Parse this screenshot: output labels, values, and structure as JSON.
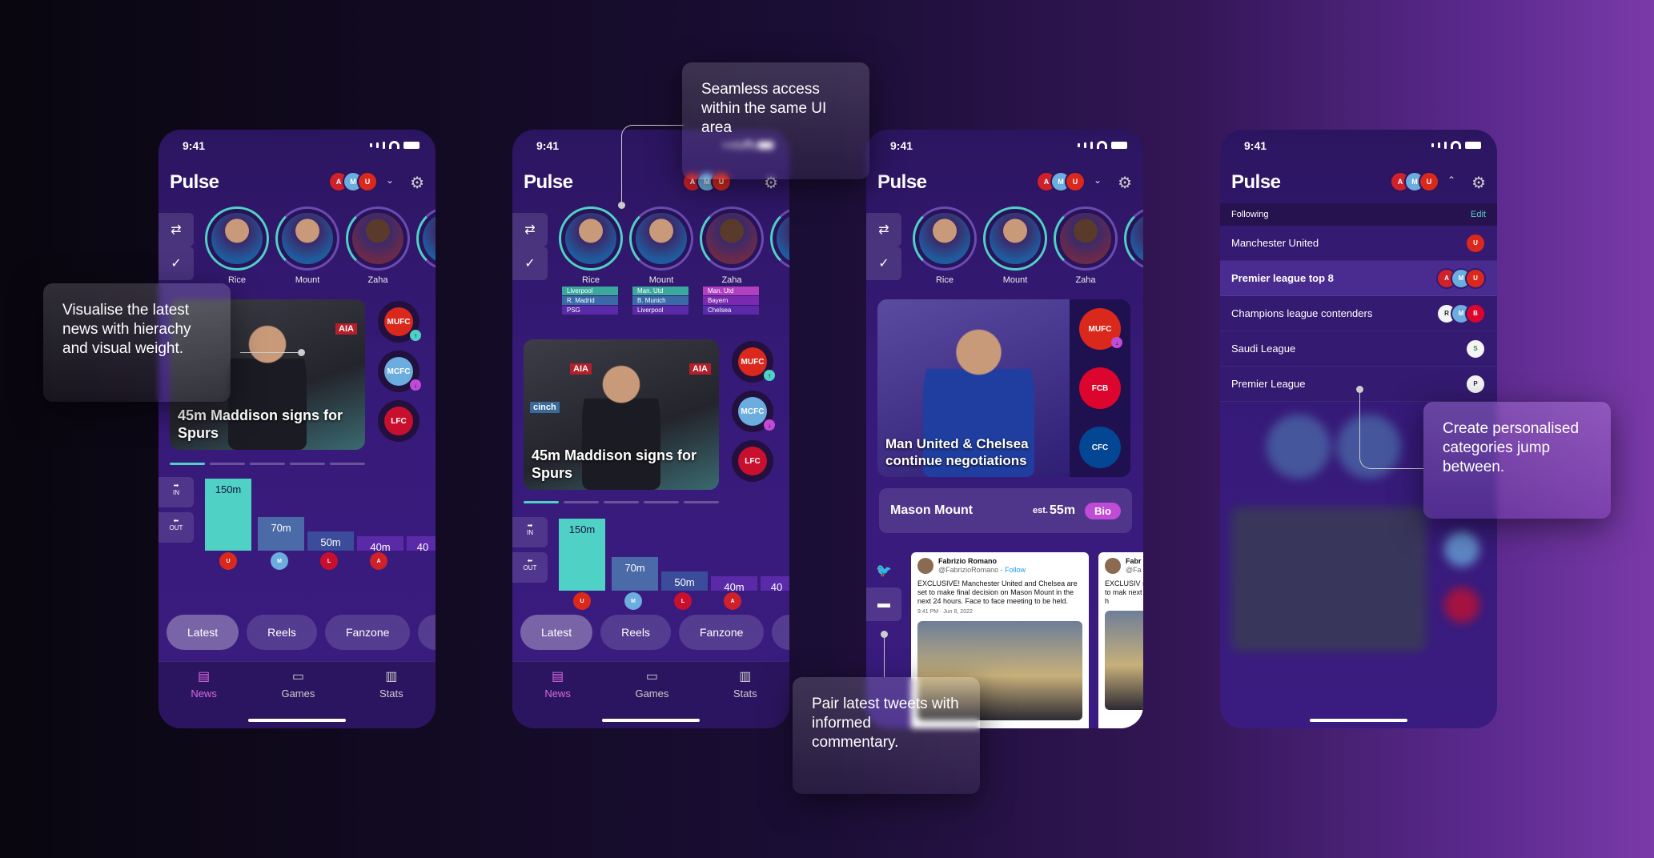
{
  "status_time": "9:41",
  "app_name": "Pulse",
  "players": [
    "Rice",
    "Mount",
    "Zaha"
  ],
  "headline": "45m Maddison signs for Spurs",
  "headline2": "Man United & Chelsea continue negotiations",
  "transfer_bars": [
    "150m",
    "70m",
    "50m",
    "40m",
    "40"
  ],
  "transfer_in": "IN",
  "transfer_out": "OUT",
  "chips": [
    "Latest",
    "Reels",
    "Fanzone",
    "Fa"
  ],
  "tabs": [
    "News",
    "Games",
    "Stats"
  ],
  "tags": {
    "rice": [
      "Liverpool",
      "R. Madrid",
      "PSG"
    ],
    "mount": [
      "Man. Utd",
      "B. Munich",
      "Liverpool"
    ],
    "zaha": [
      "Man. Utd",
      "Bayern",
      "Chelsea"
    ]
  },
  "mount_bar": {
    "name": "Mason Mount",
    "est_prefix": "est.",
    "est_value": "55m",
    "bio": "Bio"
  },
  "tweet": {
    "author": "Fabrizio Romano",
    "handle": "@FabrizioRomano",
    "follow": "Follow",
    "text": "EXCLUSIVE! Manchester United and Chelsea are set to make final decision on Mason Mount in the next 24 hours. Face to face meeting to be held.",
    "time": "9:41 PM · Jun 8, 2022"
  },
  "tweet2": {
    "author": "Fabr",
    "handle": "@Fa",
    "text": "EXCLUSIV set to mak next 24 h"
  },
  "following": {
    "title": "Following",
    "edit": "Edit",
    "items": [
      "Manchester United",
      "Premier league top 8",
      "Champions league contenders",
      "Saudi League",
      "Premier League"
    ]
  },
  "callouts": {
    "c1": "Visualise the latest news with hierachy and visual weight.",
    "c2": "Seamless access within the same UI area",
    "c3": "Pair latest tweets with informed commentary.",
    "c4": "Create personalised categories jump between."
  },
  "colors": {
    "accent": "#4fd1c5",
    "pink": "#d86ae0",
    "purple": "#361a78"
  }
}
